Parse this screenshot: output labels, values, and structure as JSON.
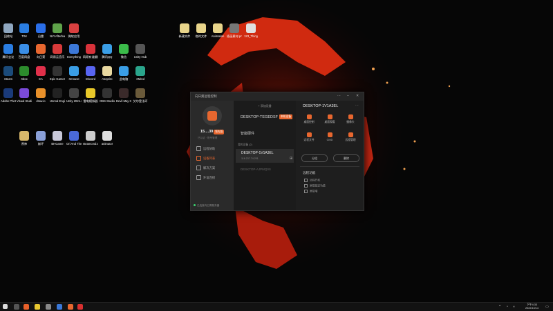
{
  "colors": {
    "accent": "#e8672f",
    "online": "#3bd16f",
    "desktop_bg": "#050505"
  },
  "desktop_icons": [
    {
      "label": "回收站",
      "color": "#8fa7c0"
    },
    {
      "label": "TIM",
      "color": "#2a7de1"
    },
    {
      "label": "迅雷",
      "color": "#2a6ee8"
    },
    {
      "label": "NVI Afterburner",
      "color": "#5fa34a"
    },
    {
      "label": "微软应用",
      "color": "#d94040"
    },
    {
      "label": "腾讯会议",
      "color": "#2a7de1"
    },
    {
      "label": "百度网盘",
      "color": "#3a8ee6"
    },
    {
      "label": "向日葵",
      "color": "#e8672f"
    },
    {
      "label": "网易云音乐",
      "color": "#d83a3a"
    },
    {
      "label": "Everything",
      "color": "#3c78d8"
    },
    {
      "label": "网易有道翻译",
      "color": "#d8323a"
    },
    {
      "label": "腾讯QQ",
      "color": "#3a9ee6"
    },
    {
      "label": "微信",
      "color": "#3bbb4a"
    },
    {
      "label": "Unity Hub",
      "color": "#555555"
    },
    {
      "label": "Steam",
      "color": "#1b4b7a"
    },
    {
      "label": "Xbox",
      "color": "#2c8c2c"
    },
    {
      "label": "EA",
      "color": "#e0304a"
    },
    {
      "label": "Epic Games Launcher",
      "color": "#333333"
    },
    {
      "label": "Xmouse",
      "color": "#3a9ee6"
    },
    {
      "label": "Discord",
      "color": "#5865f2"
    },
    {
      "label": "Aseprite",
      "color": "#e8d8a0"
    },
    {
      "label": "此电脑",
      "color": "#3a9ee6"
    },
    {
      "label": "XMind",
      "color": "#2aa58c"
    },
    {
      "label": "Adobe Photoshop",
      "color": "#1a3a7a"
    },
    {
      "label": "Visual Studio 2022",
      "color": "#7a4ad8"
    },
    {
      "label": "draw.io",
      "color": "#e8902a"
    },
    {
      "label": "Unreal Engine",
      "color": "#222222"
    },
    {
      "label": "Unity 2021.3",
      "color": "#444444"
    },
    {
      "label": "雷电模拟器",
      "color": "#e8c82a"
    },
    {
      "label": "OBS Studio",
      "color": "#333333"
    },
    {
      "label": "Devil May Cry 5",
      "color": "#3a2a2a"
    },
    {
      "label": "艾尔登法环",
      "color": "#6a5a3a"
    },
    {
      "label": "原神",
      "color": "#d8b86a"
    },
    {
      "label": "崩坏",
      "color": "#8aa0d8"
    },
    {
      "label": "BHGame",
      "color": "#c8c8d8"
    },
    {
      "label": "Ori And The Will Of The Wisps",
      "color": "#4a6ad8"
    },
    {
      "label": "steamcmd.exe",
      "color": "#cccccc"
    },
    {
      "label": "animator",
      "color": "#dddddd"
    },
    {
      "label": "新建文件",
      "color": "#e8d48a"
    },
    {
      "label": "临时文件",
      "color": "#e8d48a"
    },
    {
      "label": "Animation",
      "color": "#e8d48a"
    },
    {
      "label": "插画素材.png",
      "color": "#777777"
    },
    {
      "label": "123_Thing",
      "color": "#e0e0e0"
    }
  ],
  "window": {
    "title": "向日葵远程控制",
    "controls": [
      "⋯",
      "–",
      "✕"
    ]
  },
  "user": {
    "name": "15....39",
    "badge": "领先版",
    "sub": "已认证 · 账号管理"
  },
  "nav": [
    {
      "label": "远程协助",
      "active": false
    },
    {
      "label": "设备列表",
      "active": true
    },
    {
      "label": "解决方案",
      "active": false
    },
    {
      "label": "外设连接",
      "active": false
    }
  ],
  "status_text": "已连接向日葵服务器",
  "middle": {
    "header": "+ 添加设备",
    "primary_device": "DESKTOP-TEGEDSF",
    "current_badge": "本机设备",
    "smart_hardware": "智能硬件",
    "my_devices_label": "我的设备 (2)",
    "device_card": {
      "name": "DESKTOP-1V1A3EL",
      "id": "116.237.74.201"
    },
    "offline_device": "DESKTOP-AJPMQ0S"
  },
  "right": {
    "title": "DESKTOP-1V1A3EL",
    "more": "⋯",
    "functions": [
      {
        "label": "桌面控制"
      },
      {
        "label": "桌面观看"
      },
      {
        "label": "摄像头"
      },
      {
        "label": "远程文件"
      },
      {
        "label": "CMD"
      },
      {
        "label": "远程管理"
      }
    ],
    "buttons": [
      "分组",
      "删除"
    ],
    "remote_title": "远程功能",
    "checks": [
      "远程开机",
      "屏幕锁定功能",
      "屏幕墙"
    ]
  },
  "taskbar": {
    "time": "下午4:33",
    "date": "2022/10/14"
  }
}
